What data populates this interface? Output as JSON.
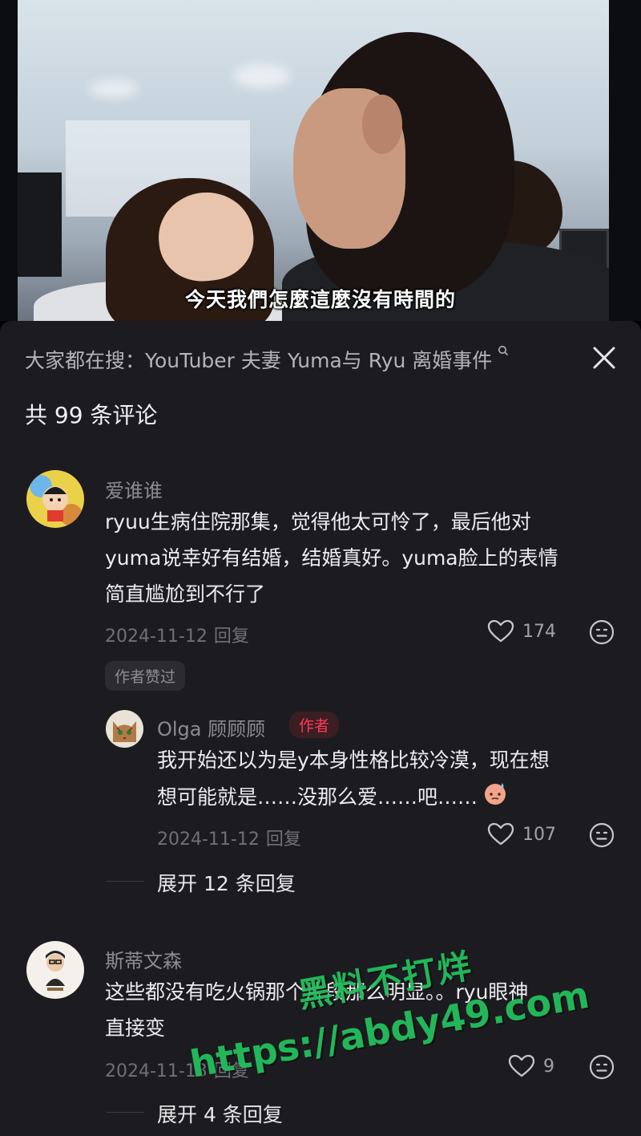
{
  "video": {
    "subtitle": "今天我們怎麼這麼沒有時間的"
  },
  "sheet": {
    "search_prefix": "大家都在搜：",
    "search_query": "YouTuber 夫妻 Yuma与 Ryu 离婚事件",
    "search_icon": "search-icon",
    "close_icon": "close-icon",
    "comment_count": "共 99 条评论"
  },
  "comments": [
    {
      "user": "爱谁谁",
      "avatar_icon": "cartoon-avatar",
      "text_line1": "ryuu生病住院那集，觉得他太可怜了，最后他对",
      "text_line2": "yuma说幸好有结婚，结婚真好。yuma脸上的表情",
      "text_line3": "简直尴尬到不行了",
      "date": "2024-11-12",
      "reply_label": "回复",
      "likes": "174",
      "author_liked_chip": "作者赞过",
      "reply": {
        "user": "Olga 顾顾顾",
        "badge": "作者",
        "avatar_icon": "cat-avatar",
        "text_line1": "我开始还以为是y本身性格比较冷漠，现在想",
        "text_line2": "想可能就是……没那么爱……吧……",
        "date": "2024-11-12",
        "reply_label": "回复",
        "likes": "107"
      },
      "expand_label": "展开 12 条回复"
    },
    {
      "user": "斯蒂文森",
      "avatar_icon": "cartoon-person-avatar",
      "text_line1": "这些都没有吃火锅那个片段那么明显。。ryu眼神",
      "text_line2": "直接变",
      "date": "2024-11-13",
      "reply_label": "回复",
      "likes": "9",
      "expand_label": "展开 4 条回复"
    }
  ],
  "watermark": {
    "line1": "黑料不打烊",
    "line2": "https://abdy49.com"
  },
  "colors": {
    "sheet_bg": "#1c1c20",
    "author_badge": "#ff3b52",
    "watermark": "#24c460"
  }
}
